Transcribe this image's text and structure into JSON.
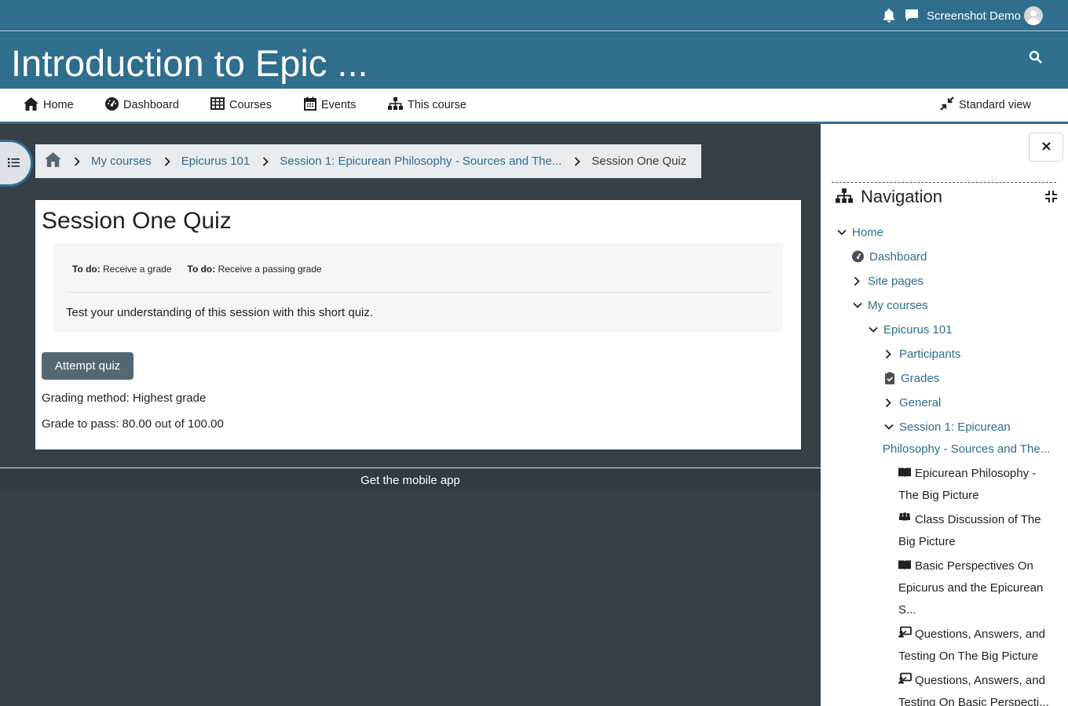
{
  "topbar": {
    "user_name": "Screenshot Demo"
  },
  "header": {
    "course_title": "Introduction to Epic ..."
  },
  "primary_nav": {
    "home": "Home",
    "dashboard": "Dashboard",
    "courses": "Courses",
    "events": "Events",
    "this_course": "This course",
    "standard_view": "Standard view"
  },
  "breadcrumb": {
    "items": [
      "My courses",
      "Epicurus 101",
      "Session 1: Epicurean Philosophy - Sources and The...",
      "Session One Quiz"
    ]
  },
  "main": {
    "title": "Session One Quiz",
    "todo_label": "To do:",
    "todo_1": "Receive a grade",
    "todo_2": "Receive a passing grade",
    "description": "Test your understanding of this session with this short quiz.",
    "attempt_button": "Attempt quiz",
    "grading_method": "Grading method: Highest grade",
    "grade_to_pass": "Grade to pass: 80.00 out of 100.00"
  },
  "footer": {
    "mobile_app": "Get the mobile app"
  },
  "drawer": {
    "title": "Navigation",
    "items": {
      "home": "Home",
      "dashboard": "Dashboard",
      "site_pages": "Site pages",
      "my_courses": "My courses",
      "epicurus": "Epicurus 101",
      "participants": "Participants",
      "grades": "Grades",
      "general": "General",
      "session1_a": "Session 1: Epicurean",
      "session1_b": "Philosophy - Sources and The...",
      "act1_a": "Epicurean Philosophy -",
      "act1_b": "The Big Picture",
      "act2_a": "Class Discussion of The",
      "act2_b": "Big Picture",
      "act3_a": "Basic Perspectives On",
      "act3_b": "Epicurus and the Epicurean",
      "act3_c": "S...",
      "act4_a": "Questions, Answers, and",
      "act4_b": "Testing On The Big Picture",
      "act5_a": "Questions, Answers, and",
      "act5_b": "Testing On Basic Perspecti..."
    }
  },
  "colors": {
    "brand": "#2f6e8d",
    "page_bg": "#373f47",
    "button": "#546873"
  }
}
